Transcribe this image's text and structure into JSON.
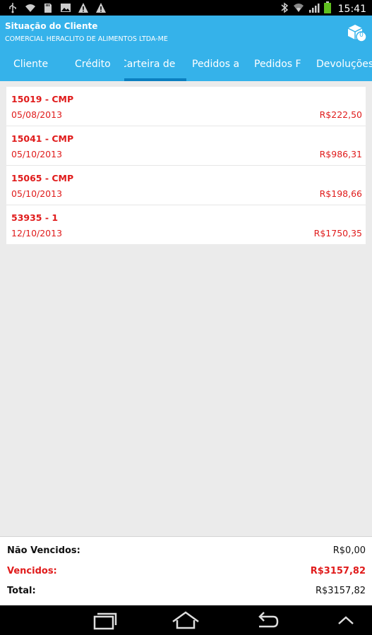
{
  "status_bar": {
    "time": "15:41",
    "left_icons": [
      "usb-icon",
      "wifi-icon",
      "sd-card-icon",
      "image-icon",
      "warning-icon",
      "warning-icon"
    ],
    "right_icons": [
      "bluetooth-icon",
      "wifi-signal-icon",
      "cell-signal-icon",
      "battery-icon"
    ]
  },
  "action_bar": {
    "title": "Situação do Cliente",
    "subtitle": "COMERCIAL HERACLITO DE ALIMENTOS LTDA-ME",
    "box_badge": "0",
    "accent_color": "#35b2ea"
  },
  "tabs": [
    {
      "label": "Cliente"
    },
    {
      "label": "Crédito"
    },
    {
      "label": "Carteira de"
    },
    {
      "label": "Pedidos a"
    },
    {
      "label": "Pedidos F"
    },
    {
      "label": "Devoluções"
    }
  ],
  "list": [
    {
      "title": "15019 - CMP",
      "date": "05/08/2013",
      "amount": "R$222,50"
    },
    {
      "title": "15041 - CMP",
      "date": "05/10/2013",
      "amount": "R$986,31"
    },
    {
      "title": "15065 - CMP",
      "date": "05/10/2013",
      "amount": "R$198,66"
    },
    {
      "title": "53935 - 1",
      "date": "12/10/2013",
      "amount": "R$1750,35"
    }
  ],
  "summary": {
    "nao_vencidos_label": "Não Vencidos:",
    "nao_vencidos_value": "R$0,00",
    "vencidos_label": "Vencidos:",
    "vencidos_value": "R$3157,82",
    "total_label": "Total:",
    "total_value": "R$3157,82"
  },
  "nav_bar": {
    "buttons": [
      "recent-apps-icon",
      "home-icon",
      "back-icon",
      "menu-up-icon"
    ]
  }
}
